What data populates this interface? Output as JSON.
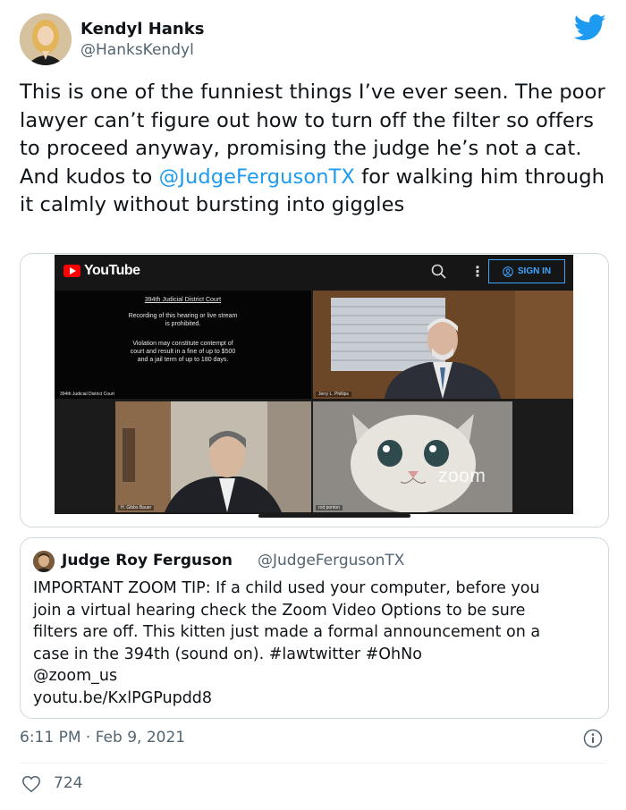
{
  "author": {
    "name": "Kendyl Hanks",
    "handle": "@HanksKendyl",
    "avatar_icon": "avatar-photo"
  },
  "brand_icon": "twitter-bird-icon",
  "tweet": {
    "text_before": "This is one of the funniest things I’ve ever seen. The poor lawyer can’t figure out how to turn off the filter so offers to proceed anyway, promising the judge he’s not a cat. And kudos to ",
    "mention": "@JudgeFergusonTX",
    "text_after": " for walking him through it calmly without bursting into giggles"
  },
  "video": {
    "logo_text": "YouTube",
    "signin_label": "SIGN IN",
    "notice": {
      "court": "394th Judicial District Court",
      "line1": "Recording of this hearing or live stream",
      "line2": "is prohibited.",
      "line3": "Violation may constitute contempt of",
      "line4": "court and result in a fine of up to $500",
      "line5": "and a jail term of up to 180 days.",
      "label": "394th Judicial District Court"
    },
    "judge_label": "Jerry L. Phillips",
    "lawyer_label": "H. Gibbs Bauer",
    "kitten_label": "rod ponton",
    "watermark": "zoom"
  },
  "quote": {
    "name": "Judge Roy Ferguson",
    "handle": "@JudgeFergusonTX",
    "line1": "IMPORTANT ZOOM TIP:  If a child used your computer, before you",
    "line2": "join a virtual hearing check the Zoom Video Options to be sure",
    "line3": "filters are off. This kitten just made a formal announcement on a",
    "line4": "case in the 394th (sound on). #lawtwitter #OhNo",
    "line5": "@zoom_us",
    "line6": "youtu.be/KxlPGPupdd8"
  },
  "timestamp": "6:11 PM · Feb 9, 2021",
  "likes": "724",
  "colors": {
    "accent": "#1d9bf0",
    "text": "#0f1419",
    "secondary": "#536471",
    "youtube_red": "#ff0000"
  }
}
